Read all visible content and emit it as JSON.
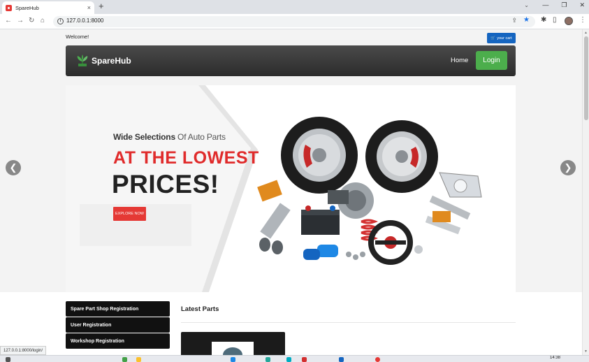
{
  "browser": {
    "tab_title": "SpareHub",
    "tab_close": "×",
    "new_tab": "+",
    "url": "127.0.0.1:8000",
    "window_controls": [
      "⌄",
      "—",
      "❐",
      "✕"
    ],
    "status_url": "127.0.0.1:8000/login/",
    "icons": [
      "back-icon",
      "forward-icon",
      "reload-icon",
      "home-icon",
      "info-icon",
      "share-icon",
      "star-icon",
      "extensions-icon",
      "side-panel-icon",
      "profile-avatar",
      "menu-icon"
    ]
  },
  "page": {
    "welcome": "Welcome!",
    "cart_label": "your cart",
    "brand": "SpareHub",
    "nav": {
      "home": "Home",
      "login": "Login"
    },
    "hero": {
      "line1_bold": "Wide Selections",
      "line1_rest": " Of Auto Parts",
      "line2": "AT THE LOWEST",
      "line3": "PRICES!",
      "cta": "EXPLORE NOW",
      "prev": "❮",
      "next": "❯"
    },
    "side_menu": [
      "Spare Part Shop Registration",
      "User Registration",
      "Workshop Registration"
    ],
    "latest_title": "Latest Parts"
  },
  "taskbar": {
    "time": "14:38"
  },
  "colors": {
    "accent_red": "#e53935",
    "login_green": "#4cae4c",
    "cart_blue": "#1565c0",
    "navbar_dark": "#333333"
  }
}
